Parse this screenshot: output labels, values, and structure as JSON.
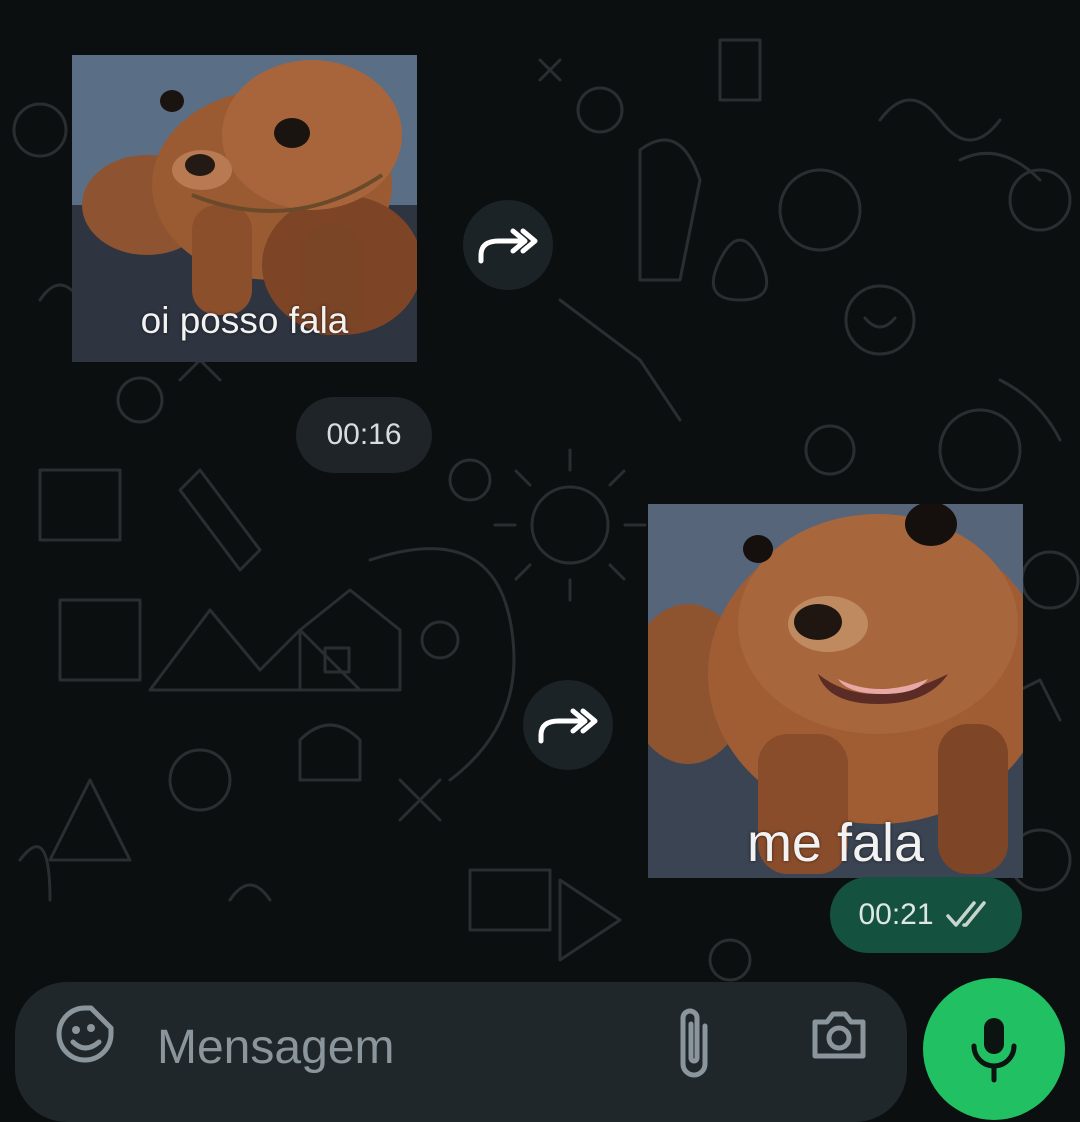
{
  "chat": {
    "messages": [
      {
        "type": "sticker",
        "direction": "incoming",
        "caption": "oi posso fala",
        "time": "00:16"
      },
      {
        "type": "sticker",
        "direction": "outgoing",
        "caption": "me fala",
        "time": "00:21",
        "status_icon": "double-check-icon"
      }
    ]
  },
  "composer": {
    "placeholder": "Mensagem",
    "icons": [
      "sticker-icon",
      "paperclip-icon",
      "camera-icon",
      "microphone-icon"
    ]
  },
  "colors": {
    "background": "#0c0f10",
    "incoming_pill": "#1e2428",
    "outgoing_pill": "#14513f",
    "composer": "#1f272b",
    "mic_button": "#21c063"
  }
}
